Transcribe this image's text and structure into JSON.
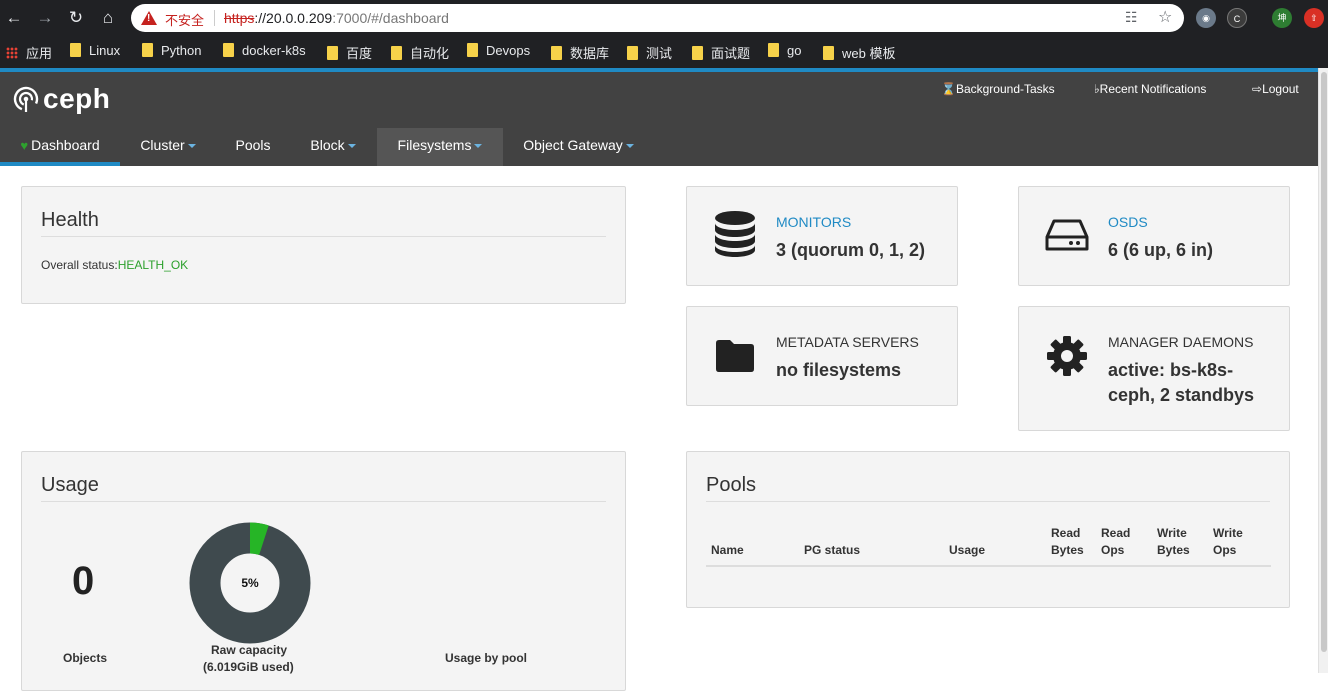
{
  "browser": {
    "insecure_label": "不安全",
    "url_scheme": "https",
    "url_host": "://20.0.0.209",
    "url_rest": ":7000/#/dashboard",
    "ext_badge": "坤"
  },
  "bookmarks": {
    "apps": "应用",
    "items": [
      "Linux",
      "Python",
      "docker-k8s",
      "百度",
      "自动化",
      "Devops",
      "数据库",
      "测试",
      "面试题",
      "go",
      "web 模板"
    ]
  },
  "ceph": {
    "brand": "ceph",
    "utility": {
      "background_tasks": "Background-Tasks",
      "notifications": "Recent Notifications",
      "logout": "Logout"
    },
    "nav": {
      "dashboard": "Dashboard",
      "cluster": "Cluster",
      "pools": "Pools",
      "block": "Block",
      "filesystems": "Filesystems",
      "object_gateway": "Object Gateway"
    },
    "accent": "#1f8ac4",
    "ok_color": "#2ca02c"
  },
  "health": {
    "title": "Health",
    "status_label": "Overall status:",
    "status_value": "HEALTH_OK"
  },
  "cards": {
    "monitors": {
      "label": "MONITORS",
      "value": "3 (quorum 0, 1, 2)",
      "icon": "database-icon"
    },
    "osds": {
      "label": "OSDS",
      "value": "6 (6 up, 6 in)",
      "icon": "hdd-icon"
    },
    "mds": {
      "label": "METADATA SERVERS",
      "value": "no filesystems",
      "icon": "folder-icon"
    },
    "mgr": {
      "label": "MANAGER DAEMONS",
      "value": "active: bs-k8s-ceph, 2 standbys",
      "icon": "gear-icon"
    }
  },
  "usage": {
    "title": "Usage",
    "objects_value": "0",
    "objects_label": "Objects",
    "raw_percent": 5,
    "raw_percent_label": "5%",
    "raw_label": "Raw capacity",
    "raw_used": "(6.019GiB used)",
    "by_pool_label": "Usage by pool"
  },
  "pools": {
    "title": "Pools",
    "columns": [
      "Name",
      "PG status",
      "Usage",
      "Read Bytes",
      "Read Ops",
      "Write Bytes",
      "Write Ops"
    ]
  }
}
